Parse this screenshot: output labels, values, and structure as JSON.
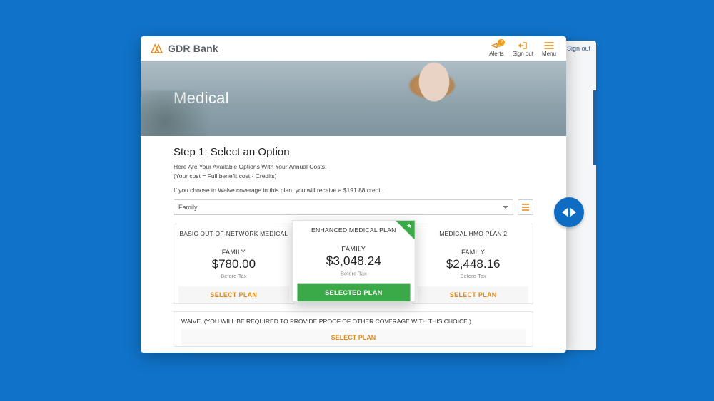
{
  "brand": {
    "name": "GDR Bank",
    "accent": "#e18a18"
  },
  "topnav": {
    "alerts": {
      "label": "Alerts",
      "count": "2"
    },
    "signout": {
      "label": "Sign out"
    },
    "menu": {
      "label": "Menu"
    }
  },
  "back_card": {
    "signout_text": "Sign out"
  },
  "hero": {
    "title": "Medical"
  },
  "step": {
    "title": "Step 1: Select an Option",
    "line1": "Here Are Your Available Options With Your Annual Costs:",
    "line2": "(Your cost = Full benefit cost - Credits)",
    "waive_hint": "If you choose to Waive coverage in this plan, you will receive a $191.88 credit."
  },
  "filter": {
    "selected": "Family"
  },
  "plans": [
    {
      "name": "BASIC OUT-OF-NETWORK MEDICAL",
      "tier": "FAMILY",
      "price": "$780.00",
      "tax": "Before-Tax",
      "button": "SELECT PLAN",
      "selected": false
    },
    {
      "name": "ENHANCED MEDICAL PLAN",
      "tier": "FAMILY",
      "price": "$3,048.24",
      "tax": "Before-Tax",
      "button": "SELECTED PLAN",
      "selected": true
    },
    {
      "name": "MEDICAL HMO PLAN 2",
      "tier": "FAMILY",
      "price": "$2,448.16",
      "tax": "Before-Tax",
      "button": "SELECT PLAN",
      "selected": false
    }
  ],
  "waive": {
    "text": "WAIVE. (YOU WILL BE REQUIRED TO PROVIDE PROOF OF OTHER COVERAGE WITH THIS CHOICE.)",
    "button": "SELECT PLAN"
  }
}
